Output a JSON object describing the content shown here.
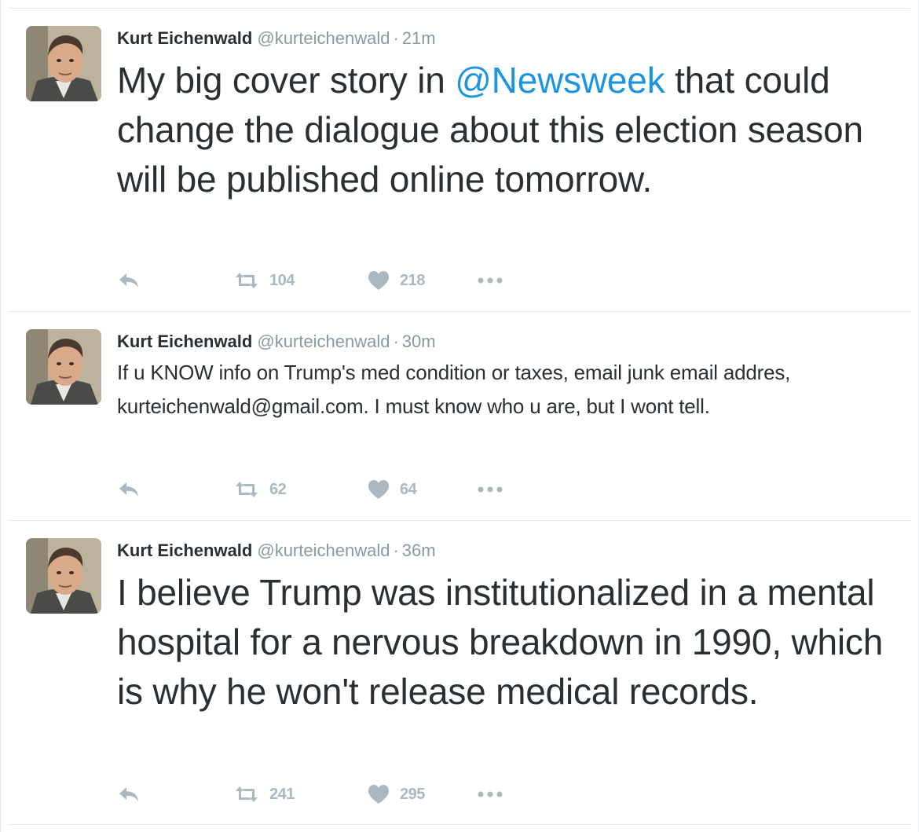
{
  "icons": {
    "reply": "reply-icon",
    "retweet": "retweet-icon",
    "like": "heart-icon",
    "more": "more-dots-icon"
  },
  "colors": {
    "mention": "#1b95e0",
    "secondary_text": "#8899a6",
    "action_icon": "#aab8c2"
  },
  "tweets": [
    {
      "fullname": "Kurt Eichenwald",
      "username": "@kurteichenwald",
      "separator": "·",
      "time": "21m",
      "text_before": "My big cover story in ",
      "mention": "@Newsweek",
      "text_after": " that could change the dialogue about this election season will be published online tomorrow.",
      "retweets": "104",
      "likes": "218"
    },
    {
      "fullname": "Kurt Eichenwald",
      "username": "@kurteichenwald",
      "separator": "·",
      "time": "30m",
      "text": "If u KNOW info on Trump's med condition or taxes, email junk email addres, kurteichenwald@gmail.com. I must know who u are, but I wont tell.",
      "retweets": "62",
      "likes": "64"
    },
    {
      "fullname": "Kurt Eichenwald",
      "username": "@kurteichenwald",
      "separator": "·",
      "time": "36m",
      "text": "I believe Trump was institutionalized in a mental hospital for a nervous breakdown in 1990, which is why he won't release medical records.",
      "retweets": "241",
      "likes": "295"
    }
  ]
}
